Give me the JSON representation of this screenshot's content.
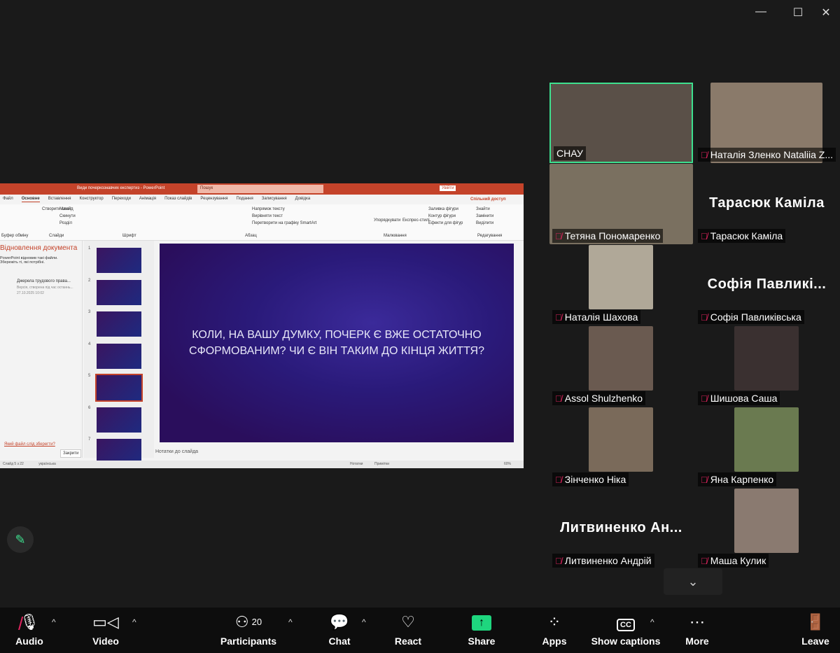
{
  "window": {
    "minimize": "—",
    "maximize": "☐",
    "close": "✕"
  },
  "ppt": {
    "title": "Види почеркознавчих експертиз - PowerPoint",
    "search": "Пошук",
    "signin": "Увійти",
    "tabs": [
      "Файл",
      "Основне",
      "Вставлення",
      "Конструктор",
      "Переходи",
      "Анімація",
      "Показ слайдів",
      "Рецензування",
      "Подання",
      "Записування",
      "Довідка"
    ],
    "share": "Спільний доступ",
    "groups": [
      "Буфер обміну",
      "Слайди",
      "Шрифт",
      "Абзац",
      "Малювання",
      "Редагування"
    ],
    "ribbon_items": [
      "Створити слайд",
      "Макет",
      "Скинути",
      "Розділ",
      "Напрямок тексту",
      "Вирівняти текст",
      "Перетворити на графіку SmartArt",
      "Упорядкувати",
      "Експрес-стилі",
      "Заливка фігури",
      "Контур фігури",
      "Ефекти для фігур",
      "Знайти",
      "Замінити",
      "Виділити"
    ],
    "recovery": {
      "title": "Відновлення документа",
      "text": "PowerPoint відновив такі файли. Збережіть ті, які потрібні.",
      "file_name": "Джерела трудового права...",
      "file_desc": "Версія, створена під час останнь...",
      "file_date": "27.10.2025 10:02",
      "link": "Який файл слід зберегти?",
      "close": "Закрити"
    },
    "slide_numbers": [
      "1",
      "2",
      "3",
      "4",
      "5",
      "6",
      "7"
    ],
    "slide_text": "КОЛИ, НА ВАШУ ДУМКУ, ПОЧЕРК Є ВЖЕ ОСТАТОЧНО СФОРМОВАНИМ? ЧИ Є ВІН ТАКИМ ДО КІНЦЯ ЖИТТЯ?",
    "notes": "Нотатки до слайда",
    "status": {
      "slide": "Слайд 5 з 22",
      "lang": "українська",
      "notes": "Нотатки",
      "comments": "Примітки",
      "zoom": "60%"
    }
  },
  "participants": [
    {
      "label": "СНАУ",
      "photo": true,
      "active": true,
      "muted": false
    },
    {
      "label": "Наталія Зленко Nataliia Z...",
      "photo": true,
      "muted": true
    },
    {
      "label": "Тетяна Пономаренко",
      "photo": true,
      "muted": true
    },
    {
      "label": "Тарасюк Каміла",
      "big": "Тарасюк Каміла",
      "muted": true
    },
    {
      "label": "Наталія Шахова",
      "photo": true,
      "muted": true
    },
    {
      "label": "Софія Павликівська",
      "big": "Софія Павликі...",
      "muted": true
    },
    {
      "label": "Assol Shulzhenko",
      "photo": true,
      "muted": true
    },
    {
      "label": "Шишова Саша",
      "photo": true,
      "muted": true
    },
    {
      "label": "Зінченко Ніка",
      "photo": true,
      "muted": true
    },
    {
      "label": "Яна Карпенко",
      "photo": true,
      "muted": true
    },
    {
      "label": "Литвиненко Андрій",
      "big": "Литвиненко Ан...",
      "muted": true
    },
    {
      "label": "Маша Кулик",
      "photo": true,
      "muted": true
    }
  ],
  "toolbar": {
    "audio": "Audio",
    "video": "Video",
    "participants": "Participants",
    "participant_count": "20",
    "chat": "Chat",
    "react": "React",
    "share": "Share",
    "apps": "Apps",
    "captions": "Show captions",
    "more": "More",
    "leave": "Leave"
  },
  "colors": {
    "active_speaker": "#3ee08f",
    "share": "#1ed67e",
    "muted": "#e0245e",
    "ppt_accent": "#c4432a"
  }
}
